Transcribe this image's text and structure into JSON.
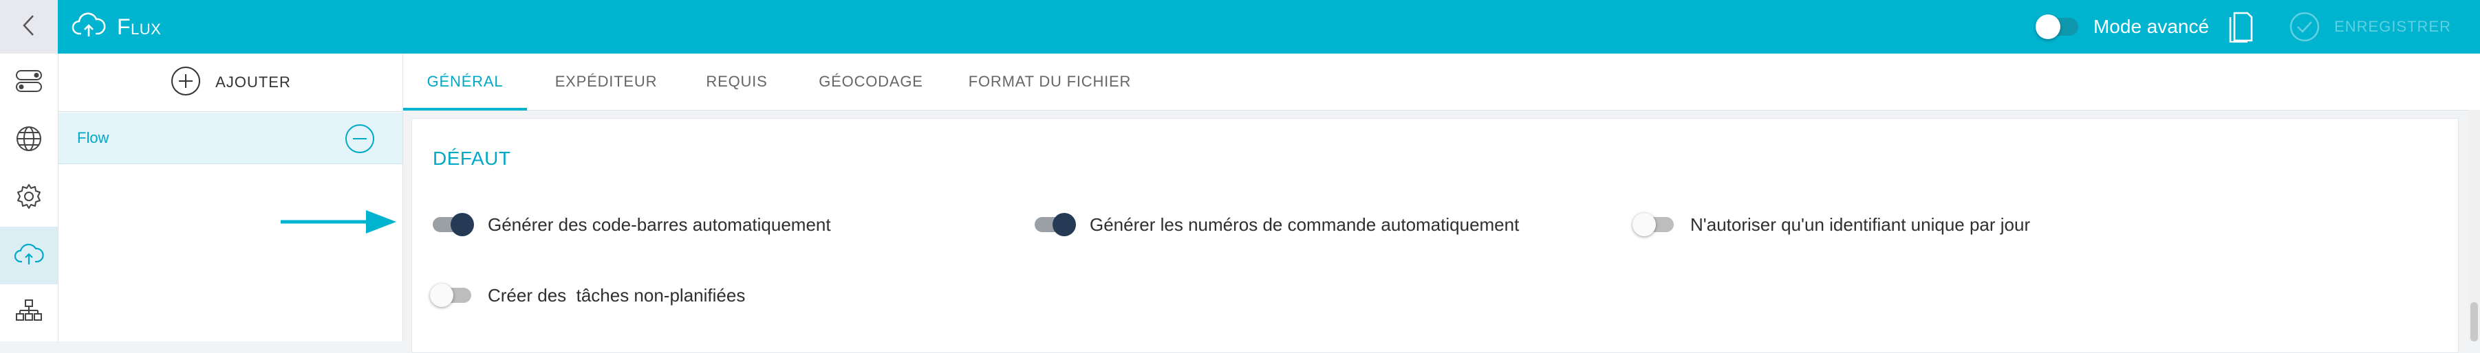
{
  "app": {
    "title": "Flux"
  },
  "toolbar": {
    "mode_label": "Mode avancé",
    "mode_enabled": false,
    "save_label": "ENREGISTRER",
    "document_icon": "document-icon",
    "check_icon": "check-circle-icon"
  },
  "rail": {
    "items": [
      {
        "icon": "toggles-icon",
        "active": false
      },
      {
        "icon": "globe-icon",
        "active": false
      },
      {
        "icon": "gear-icon",
        "active": false
      },
      {
        "icon": "cloud-upload-icon",
        "active": true
      },
      {
        "icon": "hierarchy-icon",
        "active": false
      }
    ]
  },
  "list": {
    "add_label": "AJOUTER",
    "items": [
      {
        "label": "Flow"
      }
    ]
  },
  "tabs": [
    {
      "label": "GÉNÉRAL",
      "active": true
    },
    {
      "label": "EXPÉDITEUR",
      "active": false
    },
    {
      "label": "REQUIS",
      "active": false
    },
    {
      "label": "GÉOCODAGE",
      "active": false
    },
    {
      "label": "FORMAT DU FICHIER",
      "active": false
    }
  ],
  "section": {
    "title": "DÉFAUT",
    "options": [
      {
        "label": "Générer des code-barres automatiquement",
        "enabled": true
      },
      {
        "label": "Générer les numéros de commande automatiquement",
        "enabled": true
      },
      {
        "label": "N'autoriser qu'un identifiant unique par jour",
        "enabled": false
      },
      {
        "label": "Créer des  tâches non-planifiées",
        "enabled": false
      }
    ]
  },
  "colors": {
    "accent": "#00b3cf",
    "toggle_on": "#243a55",
    "arrow": "#00b3cf"
  }
}
